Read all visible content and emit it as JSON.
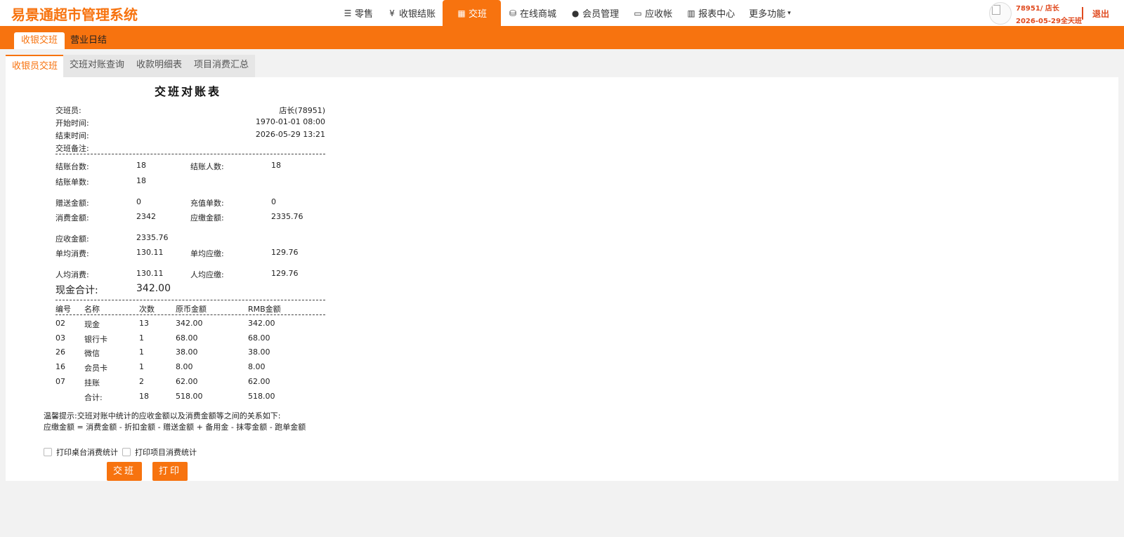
{
  "app": {
    "title": "易景通超市管理系统"
  },
  "nav": {
    "items": [
      {
        "id": "retail",
        "label": "零售",
        "icon": "list-icon",
        "glyph": "☰"
      },
      {
        "id": "checkout",
        "label": "收银结账",
        "icon": "yen-icon",
        "glyph": "¥"
      },
      {
        "id": "shift",
        "label": "交班",
        "icon": "calculator-icon",
        "glyph": "▦"
      },
      {
        "id": "mall",
        "label": "在线商城",
        "icon": "basket-icon",
        "glyph": "⛁"
      },
      {
        "id": "member",
        "label": "会员管理",
        "icon": "user-icon",
        "glyph": "●"
      },
      {
        "id": "ar",
        "label": "应收帐",
        "icon": "card-icon",
        "glyph": "▭"
      },
      {
        "id": "report",
        "label": "报表中心",
        "icon": "bar-chart-icon",
        "glyph": "▥"
      },
      {
        "id": "more",
        "label": "更多功能",
        "icon": "caret-down-icon",
        "glyph": "▾"
      }
    ]
  },
  "user": {
    "name": "78951/ 店长",
    "date": "2026-05-29全天班",
    "logout": "退出"
  },
  "subtabs": [
    {
      "label": "收银交班"
    },
    {
      "label": "营业日结"
    }
  ],
  "innertabs": [
    {
      "label": "收银员交班"
    },
    {
      "label": "交班对账查询"
    },
    {
      "label": "收款明细表"
    },
    {
      "label": "项目消费汇总"
    }
  ],
  "report": {
    "title": "交班对账表",
    "header": [
      {
        "label": "交班员:",
        "value": "店长(78951)"
      },
      {
        "label": "开始时间:",
        "value": "1970-01-01 08:00"
      },
      {
        "label": "结束时间:",
        "value": "2026-05-29 13:21"
      },
      {
        "label": "交班备注:",
        "value": ""
      }
    ],
    "stats": {
      "tables_label": "结账台数:",
      "tables": "18",
      "people_label": "结账人数:",
      "people": "18",
      "orders_label": "结账单数:",
      "orders": "18",
      "gift_label": "赠送金额:",
      "gift": "0",
      "recharge_label": "充值单数:",
      "recharge": "0",
      "consume_label": "消费金额:",
      "consume": "2342",
      "payable_label": "应缴金额:",
      "payable": "2335.76",
      "receivable_label": "应收金额:",
      "receivable": "2335.76",
      "avg_consume_order_label": "单均消费:",
      "avg_consume_order": "130.11",
      "avg_payable_order_label": "单均应缴:",
      "avg_payable_order": "129.76",
      "avg_consume_person_label": "人均消费:",
      "avg_consume_person": "130.11",
      "avg_payable_person_label": "人均应缴:",
      "avg_payable_person": "129.76",
      "cash_total_label": "现金合计:",
      "cash_total": "342.00"
    },
    "columns": [
      "编号",
      "名称",
      "次数",
      "原币金额",
      "RMB金额"
    ],
    "rows": [
      [
        "02",
        "现金",
        "13",
        "342.00",
        "342.00"
      ],
      [
        "03",
        "银行卡",
        "1",
        "68.00",
        "68.00"
      ],
      [
        "26",
        "微信",
        "1",
        "38.00",
        "38.00"
      ],
      [
        "16",
        "会员卡",
        "1",
        "8.00",
        "8.00"
      ],
      [
        "07",
        "挂账",
        "2",
        "62.00",
        "62.00"
      ],
      [
        "",
        "合计:",
        "18",
        "518.00",
        "518.00"
      ]
    ],
    "tip_line1": "温馨提示:交班对账中统计的应收金额以及消费金额等之间的关系如下:",
    "tip_line2": "应缴金额 = 消费金额 - 折扣金额 - 赠送金额 + 备用金 - 抹零金额 - 跑单金额",
    "print_table_label": "打印桌台消费统计",
    "print_item_label": "打印项目消费统计",
    "shift_button": "交班",
    "print_button": "打印"
  },
  "colors": {
    "accent": "#f7730f",
    "user": "#e04a1f"
  }
}
